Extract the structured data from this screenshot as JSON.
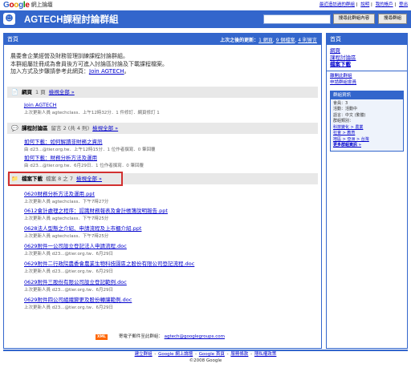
{
  "topbar": {
    "logo": "Google",
    "logo_sub": "網上論壇",
    "links": [
      "最近造訪過的群組",
      "說明",
      "我的帳戶",
      "登出"
    ]
  },
  "header": {
    "title": "AGTECH課程討論群組",
    "search_button": "搜尋此群組內容",
    "search_groups_button": "搜尋群組"
  },
  "main": {
    "title": "首頁",
    "updates_prefix": "上次之後的更新：",
    "updates": [
      "1 網頁",
      "9 個檔案",
      "4 則留言"
    ],
    "intro": [
      "農委會企業經營及財務管理訓練課程討論群組。",
      "本群組屬註冊成為會員後方可進入討論區討論及下載課程檔案。",
      "加入方式及步驟請參考此網頁："
    ],
    "intro_link": "Join AGTECH",
    "pages_section": {
      "title": "網頁",
      "count": "1 頁",
      "view_all": "檢視全部 »",
      "items": [
        {
          "title": "Join AGTECH",
          "sub": "上次更新人員 agtechclass．上午12時32分．1 件修訂．網頁修訂 1"
        }
      ]
    },
    "discussion_section": {
      "title": "課程討論區",
      "count": "留言 2 (共 4 則)",
      "view_all": "檢視全部 »",
      "items": [
        {
          "title": "如何下載：如何解讀非財務之資訊",
          "sub": "由 d23...@tier.org.tw．上午12時15分．1 位作者撰寫．0 筆回覆"
        },
        {
          "title": "如何下載：財務分析方法及運用",
          "sub": "由 d23...@tier.org.tw．6月29日．1 位作者撰寫．0 筆回覆"
        }
      ]
    },
    "files_section": {
      "title": "檔案下載",
      "count": "檔案 8 之 7",
      "view_all": "檢視全部 »"
    },
    "files": [
      {
        "title": "0620財務分析方法及運用.ppt",
        "sub": "上次更新人員 agtechclass．下午7時27分"
      },
      {
        "title": "0612會計處理之程序：認識財務報表及會計帳簿說明報告.ppt",
        "sub": "上次更新人員 agtechclass．下午7時25分"
      },
      {
        "title": "0628法人型態之介紹、申請流程及上市櫃介紹.ppt",
        "sub": "上次更新人員 agtechclass．下午7時25分"
      },
      {
        "title": "0629附件一公司設立登記法人申請流程.doc",
        "sub": "上次更新人員 d23...@tier.org.tw．6月29日"
      },
      {
        "title": "0629附件二行政院農委會農業生物科技園區之股份有限公司登記流程.doc",
        "sub": "上次更新人員 d23...@tier.org.tw．6月29日"
      },
      {
        "title": "0629附件三股份有限公司設立登記範例.doc",
        "sub": "上次更新人員 d23...@tier.org.tw．6月29日"
      },
      {
        "title": "0629附件四公司組織變更及股份轉讓範例.doc",
        "sub": "上次更新人員 d23...@tier.org.tw．6月29日"
      }
    ],
    "footer": {
      "xml": "XML",
      "email_prefix": "寄電子郵件至此群組：",
      "email": "agtech@googlegroups.com"
    }
  },
  "sidebar": {
    "header": "首頁",
    "links": [
      "網頁",
      "課程討論區",
      "檔案下載"
    ],
    "small_links": [
      "離開此群組",
      "申請群組會員"
    ],
    "info": {
      "title": "群組資訊",
      "lines": [
        "會員：3",
        "活動：活動中",
        "語言：中文 (繁體)",
        "群組類別："
      ],
      "categories": [
        "科技變化 > 農業",
        "社會 > 教育",
        "地區 > 亞洲 > 台灣"
      ],
      "more": "更多群組資訊 »"
    }
  },
  "footer": {
    "links": [
      "建立群組",
      "Google 網上論壇",
      "Google 首頁",
      "服務條款",
      "隱私權政策"
    ],
    "copyright": "©2008 Google"
  }
}
